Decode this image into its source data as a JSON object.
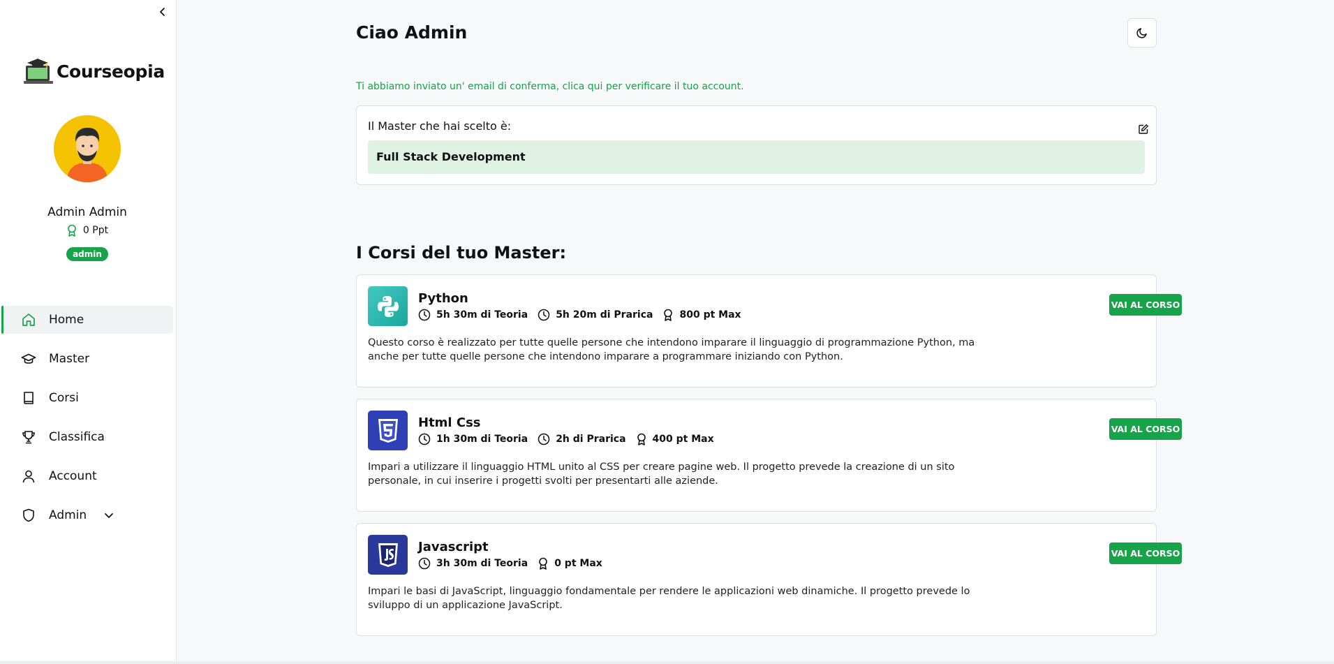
{
  "app": {
    "name": "Courseopia"
  },
  "user": {
    "name": "Admin Admin",
    "points": "0 Ppt",
    "role": "admin"
  },
  "sidebar": {
    "items": [
      {
        "label": "Home",
        "icon": "home-icon",
        "active": true
      },
      {
        "label": "Master",
        "icon": "graduation-cap-icon"
      },
      {
        "label": "Corsi",
        "icon": "book-icon"
      },
      {
        "label": "Classifica",
        "icon": "trophy-icon"
      },
      {
        "label": "Account",
        "icon": "user-icon"
      },
      {
        "label": "Admin",
        "icon": "shield-icon",
        "expandable": true
      }
    ]
  },
  "header": {
    "greeting": "Ciao Admin"
  },
  "notice": {
    "confirm_email": "Ti abbiamo inviato un' email di conferma, clica qui per verificare il tuo account."
  },
  "master": {
    "label": "Il Master che hai scelto è:",
    "value": "Full Stack Development"
  },
  "courses_section": {
    "title": "I Corsi del tuo Master:"
  },
  "courses": [
    {
      "title": "Python",
      "theory": "5h 30m di Teoria",
      "practice": "5h 20m di Prarica",
      "points": "800 pt Max",
      "description": "Questo corso è realizzato per tutte quelle persone che intendono imparare il linguaggio di programmazione Python, ma anche per tutte quelle persone che intendono imparare a programmare iniziando con Python.",
      "button": "VAI AL CORSO",
      "icon": "python-icon"
    },
    {
      "title": "Html Css",
      "theory": "1h 30m di Teoria",
      "practice": "2h di Prarica",
      "points": "400 pt Max",
      "description": "Impari a utilizzare il linguaggio HTML unito al CSS per creare pagine web. Il progetto prevede la creazione di un sito personale, in cui inserire i progetti svolti per presentarti alle aziende.",
      "button": "VAI AL CORSO",
      "icon": "html5-icon"
    },
    {
      "title": "Javascript",
      "theory": "3h 30m di Teoria",
      "points": "0 pt Max",
      "description": "Impari le basi di JavaScript, linguaggio fondamentale per rendere le applicazioni web dinamiche. Il progetto prevede lo sviluppo di un applicazione JavaScript.",
      "button": "VAI AL CORSO",
      "icon": "javascript-icon"
    }
  ],
  "colors": {
    "accent": "#16a34a",
    "master_bg": "#dff2e3",
    "avatar_bg": "#f5c200"
  }
}
